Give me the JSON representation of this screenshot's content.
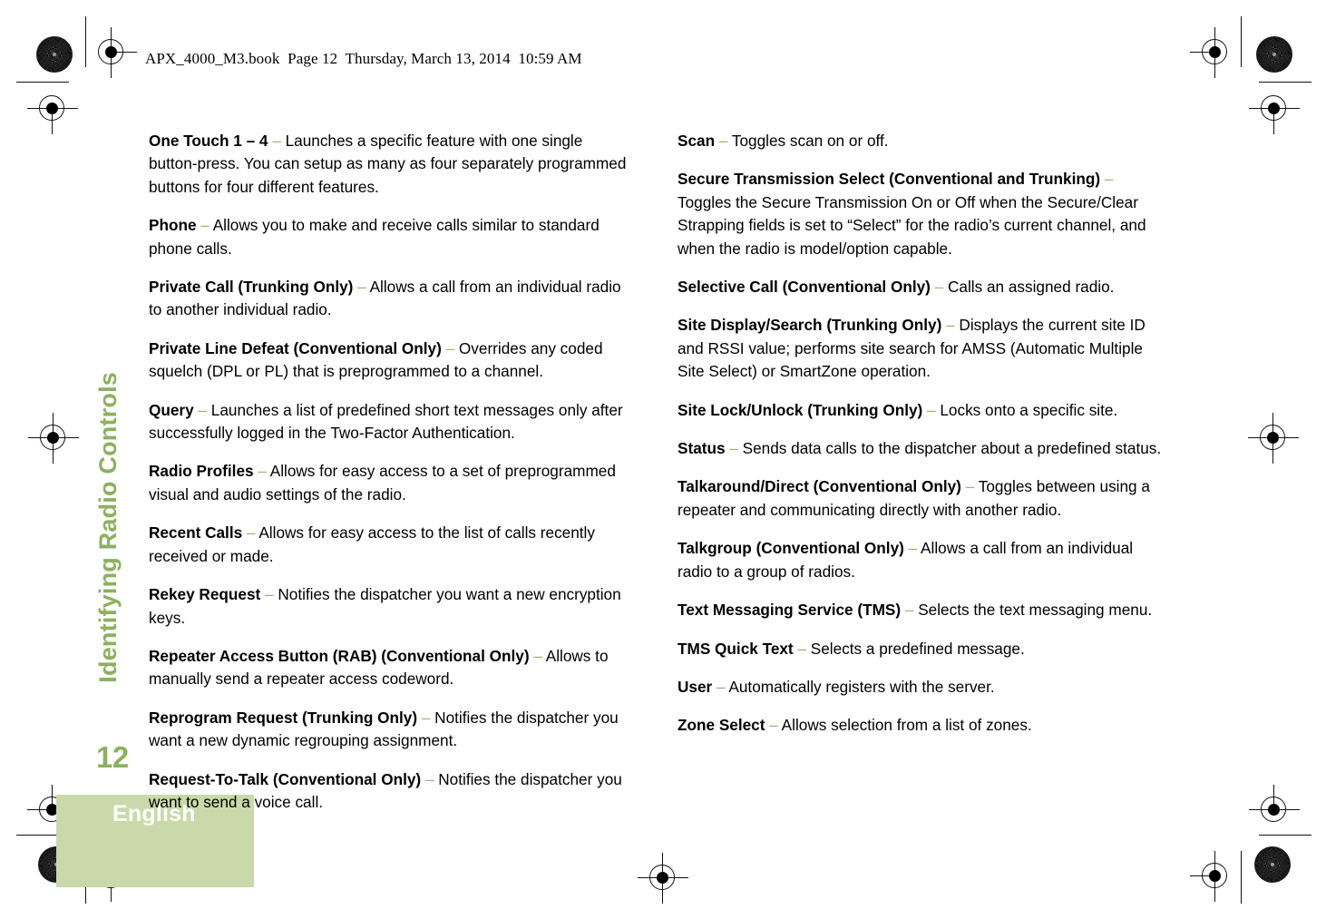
{
  "header": {
    "book_line": "APX_4000_M3.book  Page 12  Thursday, March 13, 2014  10:59 AM"
  },
  "sidebar": {
    "chapter_title": "Identifying Radio Controls",
    "page_number": "12",
    "language": "English",
    "accent_color": "#8cb15f",
    "band_color": "#c9d9a9",
    "dash_color": "#9bb36d"
  },
  "columns": {
    "left": [
      {
        "term": "One Touch 1 – 4",
        "dash": "–",
        "definition": "Launches a specific feature with one single button-press. You can setup as many as four separately programmed buttons for four different features."
      },
      {
        "term": "Phone",
        "dash": "–",
        "definition": "Allows you to make and receive calls similar to standard phone calls."
      },
      {
        "term": "Private Call (Trunking Only)",
        "dash": "–",
        "definition": "Allows a call from an individual radio to another individual radio."
      },
      {
        "term": "Private Line Defeat (Conventional Only)",
        "dash": "–",
        "definition": "Overrides any coded squelch (DPL or PL) that is preprogrammed to a channel."
      },
      {
        "term": "Query",
        "dash": "–",
        "definition": "Launches a list of predefined short text messages only after successfully logged in the Two-Factor Authentication."
      },
      {
        "term": "Radio Profiles",
        "dash": "–",
        "definition": "Allows for easy access to a set of preprogrammed visual and audio settings of the radio."
      },
      {
        "term": "Recent Calls",
        "dash": "–",
        "definition": "Allows for easy access to the list of calls recently received or made."
      },
      {
        "term": "Rekey Request",
        "dash": "–",
        "definition": "Notifies the dispatcher you want a new encryption keys."
      },
      {
        "term": "Repeater Access Button (RAB) (Conventional Only)",
        "dash": "–",
        "definition": "Allows to manually send a repeater access codeword."
      },
      {
        "term": "Reprogram Request (Trunking Only)",
        "dash": "–",
        "definition": "Notifies the dispatcher you want a new dynamic regrouping assignment."
      },
      {
        "term": "Request-To-Talk (Conventional Only)",
        "dash": "–",
        "definition": "Notifies the dispatcher you want to send a voice call."
      }
    ],
    "right": [
      {
        "term": "Scan",
        "dash": "–",
        "definition": "Toggles scan on or off."
      },
      {
        "term": "Secure Transmission Select (Conventional and Trunking)",
        "dash": "–",
        "definition": "Toggles the Secure Transmission On or Off when the Secure/Clear Strapping fields is set to “Select” for the radio’s current channel, and when the radio is model/option capable."
      },
      {
        "term": "Selective Call (Conventional Only)",
        "dash": "–",
        "definition": "Calls an assigned radio."
      },
      {
        "term": "Site Display/Search (Trunking Only)",
        "dash": "–",
        "definition": "Displays the current site ID and RSSI value; performs site search for AMSS (Automatic Multiple Site Select) or SmartZone operation."
      },
      {
        "term": "Site Lock/Unlock (Trunking Only)",
        "dash": "–",
        "definition": "Locks onto a specific site."
      },
      {
        "term": "Status",
        "dash": "–",
        "definition": "Sends data calls to the dispatcher about a predefined status."
      },
      {
        "term": "Talkaround/Direct (Conventional Only)",
        "dash": "–",
        "definition": "Toggles between using a repeater and communicating directly with another radio."
      },
      {
        "term": "Talkgroup (Conventional Only)",
        "dash": "–",
        "definition": "Allows a call from an individual radio to a group of radios."
      },
      {
        "term": "Text Messaging Service (TMS)",
        "dash": "–",
        "definition": "Selects the text messaging menu."
      },
      {
        "term": "TMS Quick Text",
        "dash": "–",
        "definition": "Selects a predefined message."
      },
      {
        "term": "User",
        "dash": "–",
        "definition": "Automatically registers with the server."
      },
      {
        "term": "Zone Select",
        "dash": "–",
        "definition": "Allows selection from a list of zones."
      }
    ]
  },
  "print_marks": {
    "registration_icon": "registration-crosshair-icon",
    "density_icon": "density-starburst-icon"
  }
}
